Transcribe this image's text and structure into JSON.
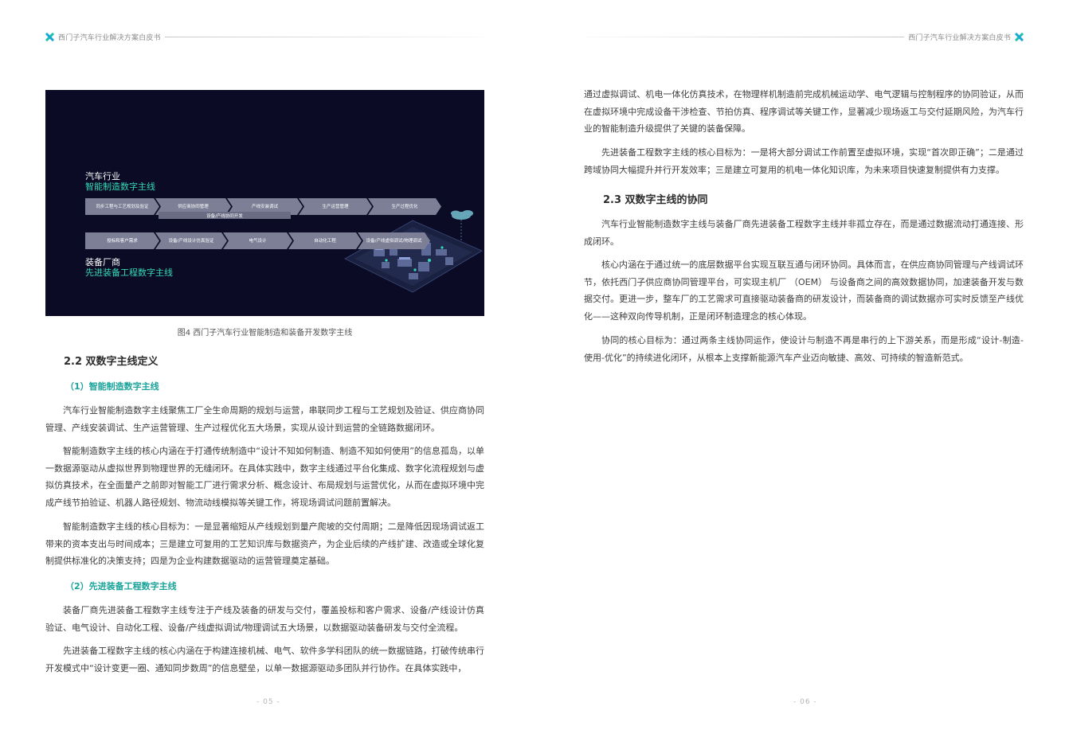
{
  "header": {
    "title": "西门子汽车行业解决方案白皮书"
  },
  "figure": {
    "top_label_line1": "汽车行业",
    "top_label_line2": "智能制造数字主线",
    "top_row": [
      "同步工程与工艺规划及验证",
      "供应商协同管理",
      "产线安装调试",
      "生产运营管理",
      "生产过程优化"
    ],
    "shared_bar": "设备/产线协同开发",
    "bottom_row": [
      "投标和客户需求",
      "设备/产线设计仿真验证",
      "电气设计",
      "自动化工程",
      "设备/产线虚拟调试/物理调试"
    ],
    "bottom_label_line1": "装备厂商",
    "bottom_label_line2": "先进装备工程数字主线",
    "caption": "图4 西门子汽车行业智能制造和装备开发数字主线"
  },
  "left": {
    "section_title": "2.2 双数字主线定义",
    "sub1_title": "（1）智能制造数字主线",
    "p1": "汽车行业智能制造数字主线聚焦工厂全生命周期的规划与运营，串联同步工程与工艺规划及验证、供应商协同管理、产线安装调试、生产运营管理、生产过程优化五大场景，实现从设计到运营的全链路数据闭环。",
    "p2": "智能制造数字主线的核心内涵在于打通传统制造中“设计不知如何制造、制造不知如何使用”的信息孤岛，以单一数据源驱动从虚拟世界到物理世界的无缝闭环。在具体实践中，数字主线通过平台化集成、数字化流程规划与虚拟仿真技术，在全面量产之前即对智能工厂进行需求分析、概念设计、布局规划与运营优化，从而在虚拟环境中完成产线节拍验证、机器人路径规划、物流动线模拟等关键工作，将现场调试问题前置解决。",
    "p3": "智能制造数字主线的核心目标为：一是显著缩短从产线规划到量产爬坡的交付周期；二是降低因现场调试返工带来的资本支出与时间成本；三是建立可复用的工艺知识库与数据资产，为企业后续的产线扩建、改造或全球化复制提供标准化的决策支持；四是为企业构建数据驱动的运营管理奠定基础。",
    "sub2_title": "（2）先进装备工程数字主线",
    "p4": "装备厂商先进装备工程数字主线专注于产线及装备的研发与交付，覆盖投标和客户需求、设备/产线设计仿真验证、电气设计、自动化工程、设备/产线虚拟调试/物理调试五大场景，以数据驱动装备研发与交付全流程。",
    "p5": "先进装备工程数字主线的核心内涵在于构建连接机械、电气、软件多学科团队的统一数据链路，打破传统串行开发模式中“设计变更一圈、通知同步数周”的信息壁垒，以单一数据源驱动多团队并行协作。在具体实践中，",
    "page_number": "- 05 -"
  },
  "right": {
    "p1": "通过虚拟调试、机电一体化仿真技术，在物理样机制造前完成机械运动学、电气逻辑与控制程序的协同验证，从而在虚拟环境中完成设备干涉检查、节拍仿真、程序调试等关键工作，显著减少现场返工与交付延期风险，为汽车行业的智能制造升级提供了关键的装备保障。",
    "p2": "先进装备工程数字主线的核心目标为：一是将大部分调试工作前置至虚拟环境，实现“首次即正确”；二是通过跨域协同大幅提升并行开发效率；三是建立可复用的机电一体化知识库，为未来项目快速复制提供有力支撑。",
    "section_title": "2.3 双数字主线的协同",
    "p3": "汽车行业智能制造数字主线与装备厂商先进装备工程数字主线并非孤立存在，而是通过数据流动打通连接、形成闭环。",
    "p4": "核心内涵在于通过统一的底层数据平台实现互联互通与闭环协同。具体而言，在供应商协同管理与产线调试环节，依托西门子供应商协同管理平台，可实现主机厂 （OEM） 与设备商之间的高效数据协同，加速装备开发与数据交付。更进一步，整车厂的工艺需求可直接驱动装备商的研发设计，而装备商的调试数据亦可实时反馈至产线优化——这种双向传导机制，正是闭环制造理念的核心体现。",
    "p5": "协同的核心目标为：通过两条主线协同运作，使设计与制造不再是串行的上下游关系，而是形成“设计-制造-使用-优化”的持续进化闭环，从根本上支撑新能源汽车产业迈向敏捷、高效、可持续的智造新范式。",
    "page_number": "- 06 -"
  },
  "colors": {
    "accent_teal": "#1aa39a",
    "figure_bg": "#0b0b25",
    "figure_highlight": "#35d9b8"
  }
}
